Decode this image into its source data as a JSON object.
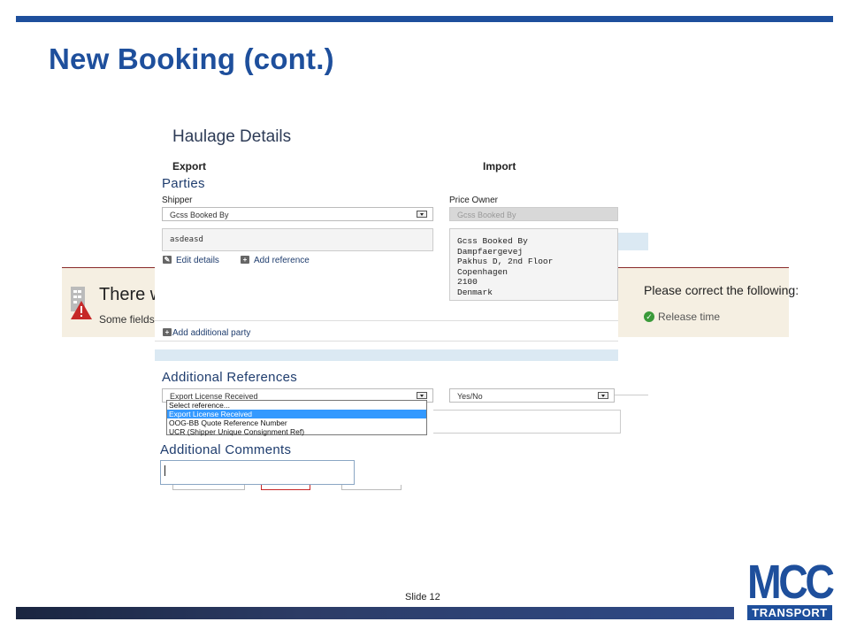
{
  "slide": {
    "title": "New Booking (cont.)",
    "slide_number": "Slide 12"
  },
  "error_banner": {
    "title_fragment": "There w",
    "subtitle_fragment": "Some fields a",
    "right_title": "Please correct the following:",
    "right_item": "Release time"
  },
  "haulage": {
    "title": "Haulage Details",
    "export_label": "Export",
    "import_label": "Import"
  },
  "parties": {
    "title": "Parties",
    "shipper_label": "Shipper",
    "shipper_value": "Gcss Booked By",
    "shipper_text": "asdeasd",
    "price_owner_label": "Price Owner",
    "price_owner_value": "Gcss Booked By",
    "address_lines": [
      "Gcss Booked By",
      "Dampfaergevej",
      "Pakhus D, 2nd Floor",
      "Copenhagen",
      "2100",
      "Denmark"
    ],
    "edit_details": "Edit details",
    "add_reference": "Add reference",
    "add_party": "Add additional party"
  },
  "references": {
    "title": "Additional References",
    "selected": "Export License Received",
    "yes_no": "Yes/No",
    "options": [
      "Select reference...",
      "Export License Received",
      "OOG-BB Quote Reference Number",
      "UCR (Shipper Unique Consignment Ref)"
    ],
    "selected_index": 1
  },
  "comments": {
    "title": "Additional Comments",
    "value": ""
  },
  "logo": {
    "main": "MCC",
    "sub": "TRANSPORT"
  },
  "colors": {
    "brand": "#1e4f9c",
    "link": "#1f3d6e",
    "selected_option": "#3399ff"
  }
}
